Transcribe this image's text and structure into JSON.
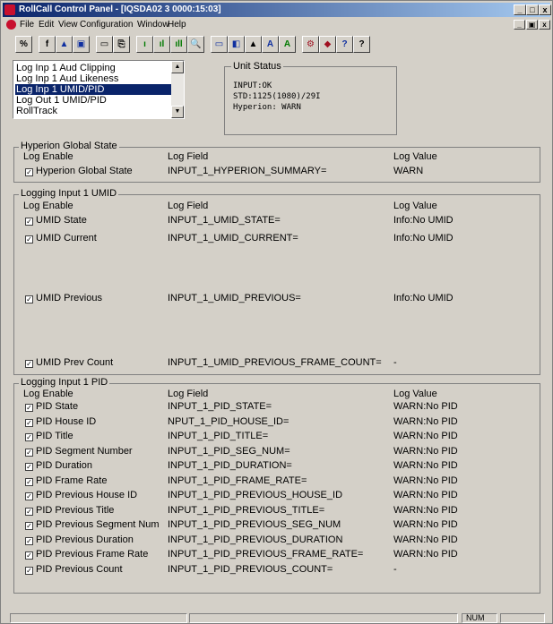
{
  "window": {
    "title": "RollCall Control Panel - [IQSDA02 3 0000:15:03]",
    "caption_buttons": [
      "_",
      "□",
      "x"
    ],
    "mdi_buttons": [
      "_",
      "▣",
      "x"
    ]
  },
  "menu": [
    "File",
    "Edit",
    "View",
    "Configuration",
    "Window",
    "Help"
  ],
  "toolbar": [
    "%",
    "f",
    "▲",
    "▣",
    "▭",
    "⎘",
    "ı",
    "ıl",
    "ıll",
    "🔍",
    "▭",
    "◧",
    "▲",
    "A",
    "A",
    "⚙",
    "◆",
    "?",
    "?"
  ],
  "listbox": {
    "items": [
      "Log Inp 1 Aud Clipping",
      "Log Inp 1 Aud Likeness",
      "Log Inp 1 UMID/PID",
      "Log Out 1 UMID/PID",
      "RollTrack"
    ],
    "selected_index": 2,
    "scroll_up": "▲",
    "scroll_down": "▼"
  },
  "unit_status": {
    "label": "Unit Status",
    "lines": [
      "INPUT:OK",
      "STD:1125(1080)/29I",
      "Hyperion: WARN"
    ]
  },
  "headers": {
    "enable": "Log Enable",
    "field": "Log Field",
    "value": "Log Value"
  },
  "hyperion": {
    "label": "Hyperion Global State",
    "rows": [
      {
        "enable_label": "Hyperion Global State",
        "field": "INPUT_1_HYPERION_SUMMARY=",
        "value": "WARN",
        "checked": true
      }
    ]
  },
  "umid": {
    "label": "Logging Input 1 UMID",
    "rows": [
      {
        "enable_label": "UMID State",
        "field": "INPUT_1_UMID_STATE=",
        "value": "Info:No UMID",
        "checked": true
      },
      {
        "enable_label": "UMID Current",
        "field": "INPUT_1_UMID_CURRENT=",
        "value": "Info:No UMID",
        "checked": true
      },
      {
        "enable_label": "UMID Previous",
        "field": "INPUT_1_UMID_PREVIOUS=",
        "value": "Info:No UMID",
        "checked": true
      },
      {
        "enable_label": "UMID Prev Count",
        "field": "INPUT_1_UMID_PREVIOUS_FRAME_COUNT=",
        "value": "-",
        "checked": true
      }
    ]
  },
  "pid": {
    "label": "Logging Input 1 PID",
    "rows": [
      {
        "enable_label": "PID State",
        "field": "INPUT_1_PID_STATE=",
        "value": "WARN:No PID",
        "checked": true
      },
      {
        "enable_label": "PID House ID",
        "field": "NPUT_1_PID_HOUSE_ID=",
        "value": "WARN:No PID",
        "checked": true
      },
      {
        "enable_label": "PID Title",
        "field": "INPUT_1_PID_TITLE=",
        "value": "WARN:No PID",
        "checked": true
      },
      {
        "enable_label": "PID Segment Number",
        "field": "INPUT_1_PID_SEG_NUM=",
        "value": "WARN:No PID",
        "checked": true
      },
      {
        "enable_label": "PID Duration",
        "field": "INPUT_1_PID_DURATION=",
        "value": "WARN:No PID",
        "checked": true
      },
      {
        "enable_label": "PID Frame Rate",
        "field": "INPUT_1_PID_FRAME_RATE=",
        "value": "WARN:No PID",
        "checked": true
      },
      {
        "enable_label": "PID Previous House ID",
        "field": "INPUT_1_PID_PREVIOUS_HOUSE_ID",
        "value": "WARN:No PID",
        "checked": true
      },
      {
        "enable_label": "PID Previous Title",
        "field": "INPUT_1_PID_PREVIOUS_TITLE=",
        "value": "WARN:No PID",
        "checked": true
      },
      {
        "enable_label": "PID Previous Segment Num",
        "field": "INPUT_1_PID_PREVIOUS_SEG_NUM",
        "value": "WARN:No PID",
        "checked": true
      },
      {
        "enable_label": "PID Previous Duration",
        "field": "INPUT_1_PID_PREVIOUS_DURATION",
        "value": "WARN:No PID",
        "checked": true
      },
      {
        "enable_label": "PID Previous Frame Rate",
        "field": "INPUT_1_PID_PREVIOUS_FRAME_RATE=",
        "value": "WARN:No PID",
        "checked": true
      },
      {
        "enable_label": "PID Previous Count",
        "field": "INPUT_1_PID_PREVIOUS_COUNT=",
        "value": "-",
        "checked": true
      }
    ]
  },
  "statusbar": {
    "num": "NUM"
  },
  "check_mark": "✓",
  "colors": {
    "titlebar_start": "#0a246a",
    "titlebar_end": "#a6caf0",
    "face": "#d4d0c8",
    "selection": "#0a246a"
  }
}
